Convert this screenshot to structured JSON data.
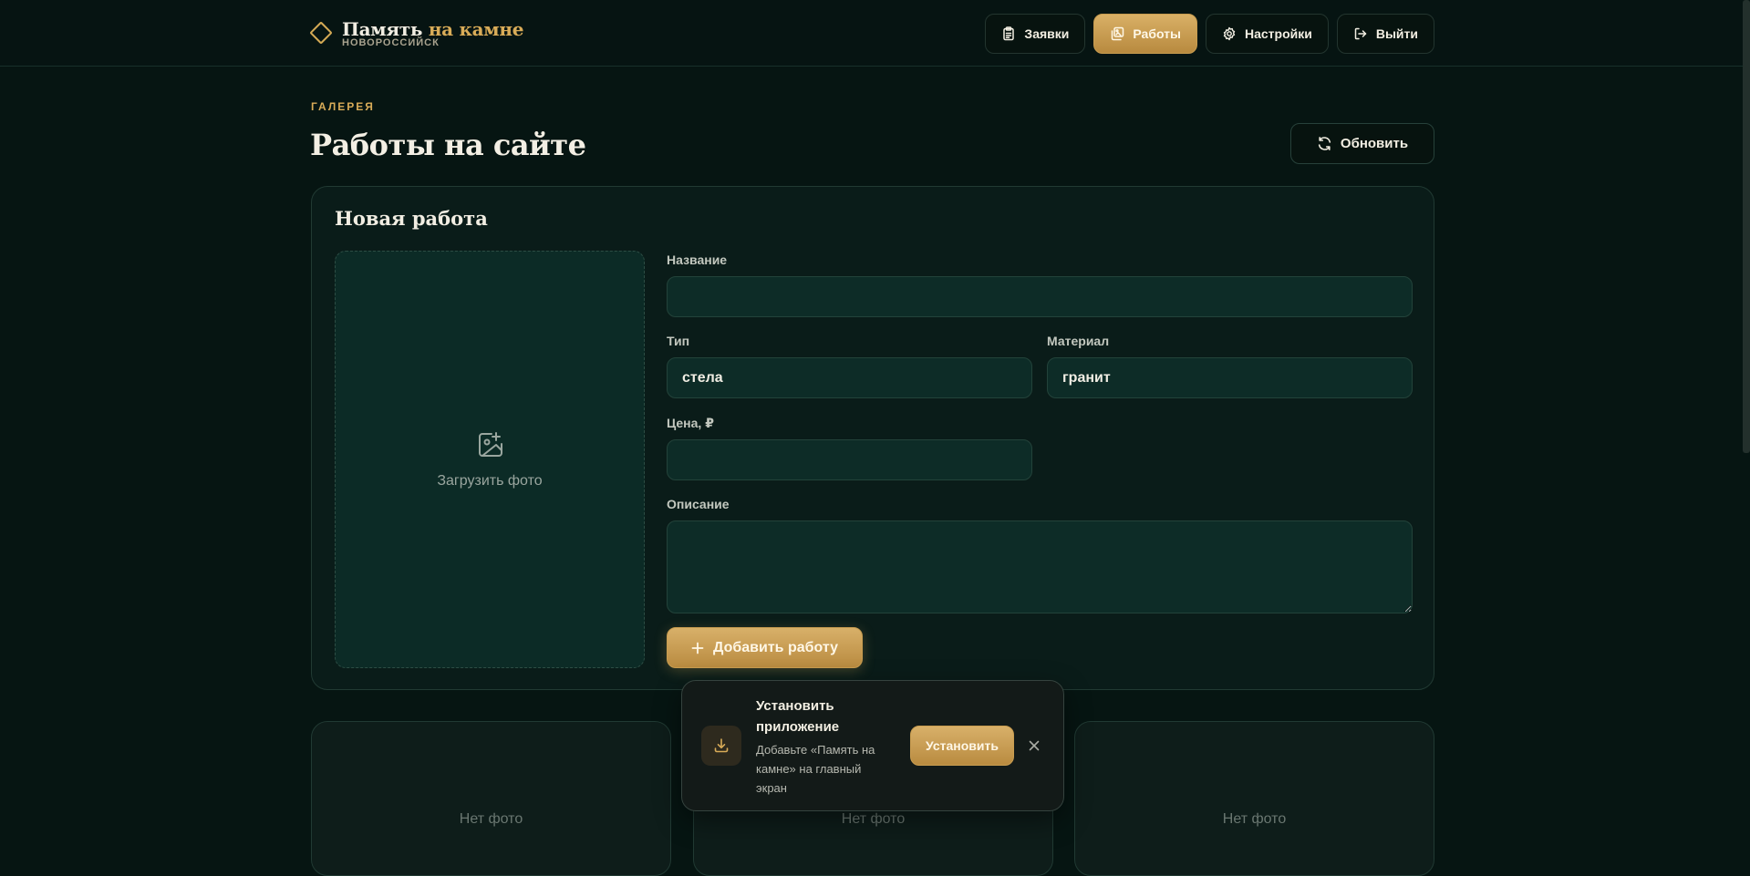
{
  "brand": {
    "title_main": "Память",
    "title_accent": "на камне",
    "subtitle": "НОВОРОССИЙСК"
  },
  "nav": {
    "items": [
      {
        "label": "Заявки",
        "icon": "clipboard-icon",
        "active": false
      },
      {
        "label": "Работы",
        "icon": "images-icon",
        "active": true
      },
      {
        "label": "Настройки",
        "icon": "gear-icon",
        "active": false
      },
      {
        "label": "Выйти",
        "icon": "logout-icon",
        "active": false
      }
    ]
  },
  "page": {
    "eyebrow": "ГАЛЕРЕЯ",
    "title": "Работы на сайте",
    "refresh_label": "Обновить"
  },
  "form": {
    "title": "Новая работа",
    "upload_label": "Загрузить фото",
    "name_label": "Название",
    "name_value": "",
    "type_label": "Тип",
    "type_value": "стела",
    "material_label": "Материал",
    "material_value": "гранит",
    "price_label": "Цена, ₽",
    "price_value": "",
    "description_label": "Описание",
    "description_value": "",
    "submit_label": "Добавить работу"
  },
  "gallery": {
    "cards": [
      {
        "placeholder": "Нет фото"
      },
      {
        "placeholder": "Нет фото"
      },
      {
        "placeholder": "Нет фото"
      }
    ]
  },
  "install_prompt": {
    "title": "Установить приложение",
    "text": "Добавьте «Память на камне» на главный экран",
    "button_label": "Установить"
  },
  "colors": {
    "background": "#061512",
    "accent": "#d9ac58",
    "card": "#0a1c19",
    "field": "#0d2c27"
  }
}
